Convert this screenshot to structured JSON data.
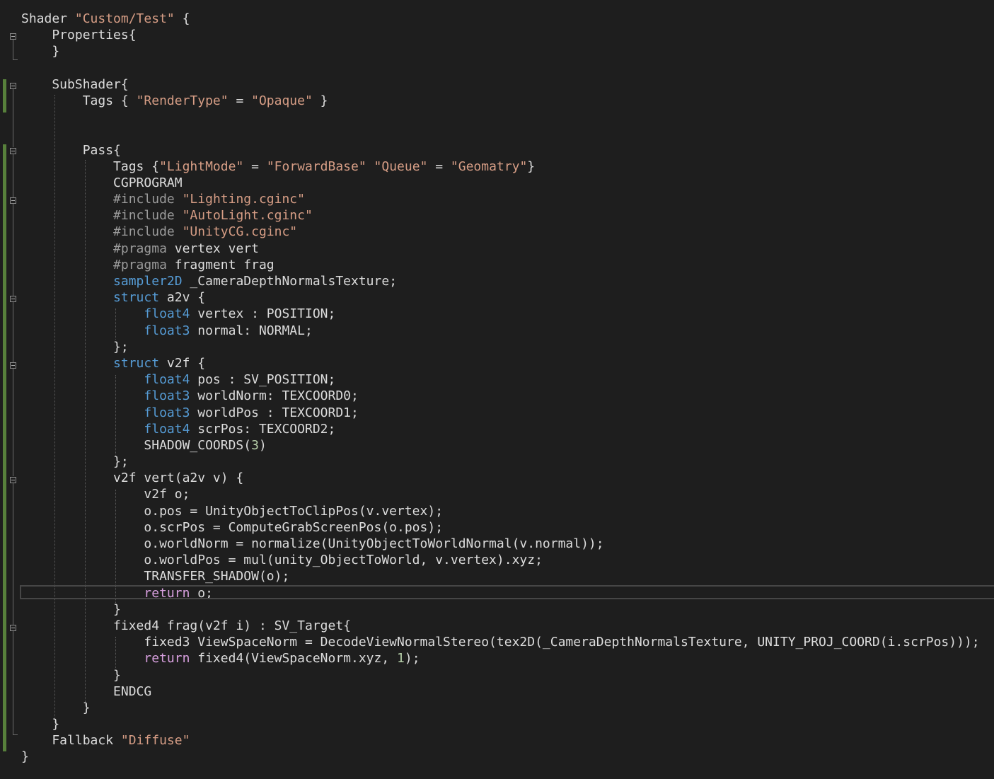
{
  "lines": [
    [
      [
        "",
        "Shader "
      ],
      [
        "str",
        "\"Custom/Test\""
      ],
      [
        "",
        " {"
      ]
    ],
    [
      [
        "",
        "    Properties{"
      ]
    ],
    [
      [
        "",
        "    }"
      ]
    ],
    [],
    [
      [
        "",
        "    SubShader{"
      ]
    ],
    [
      [
        "",
        "        Tags { "
      ],
      [
        "str",
        "\"RenderType\""
      ],
      [
        "",
        " = "
      ],
      [
        "str",
        "\"Opaque\""
      ],
      [
        "",
        " }"
      ]
    ],
    [],
    [],
    [
      [
        "",
        "        Pass{"
      ]
    ],
    [
      [
        "",
        "            Tags {"
      ],
      [
        "str",
        "\"LightMode\""
      ],
      [
        "",
        " = "
      ],
      [
        "str",
        "\"ForwardBase\""
      ],
      [
        "",
        " "
      ],
      [
        "str",
        "\"Queue\""
      ],
      [
        "",
        " = "
      ],
      [
        "str",
        "\"Geomatry\""
      ],
      [
        "",
        "}"
      ]
    ],
    [
      [
        "",
        "            CGPROGRAM"
      ]
    ],
    [
      [
        "",
        "            "
      ],
      [
        "pre",
        "#include"
      ],
      [
        "",
        " "
      ],
      [
        "str",
        "\"Lighting.cginc\""
      ]
    ],
    [
      [
        "",
        "            "
      ],
      [
        "pre",
        "#include"
      ],
      [
        "",
        " "
      ],
      [
        "str",
        "\"AutoLight.cginc\""
      ]
    ],
    [
      [
        "",
        "            "
      ],
      [
        "pre",
        "#include"
      ],
      [
        "",
        " "
      ],
      [
        "str",
        "\"UnityCG.cginc\""
      ]
    ],
    [
      [
        "",
        "            "
      ],
      [
        "pre",
        "#pragma"
      ],
      [
        "",
        " vertex vert"
      ]
    ],
    [
      [
        "",
        "            "
      ],
      [
        "pre",
        "#pragma"
      ],
      [
        "",
        " fragment frag"
      ]
    ],
    [
      [
        "",
        "            "
      ],
      [
        "kw",
        "sampler2D"
      ],
      [
        "",
        " _CameraDepthNormalsTexture;"
      ]
    ],
    [
      [
        "",
        "            "
      ],
      [
        "kw",
        "struct"
      ],
      [
        "",
        " a2v {"
      ]
    ],
    [
      [
        "",
        "                "
      ],
      [
        "kw",
        "float4"
      ],
      [
        "",
        " vertex : POSITION;"
      ]
    ],
    [
      [
        "",
        "                "
      ],
      [
        "kw",
        "float3"
      ],
      [
        "",
        " normal: NORMAL;"
      ]
    ],
    [
      [
        "",
        "            };"
      ]
    ],
    [
      [
        "",
        "            "
      ],
      [
        "kw",
        "struct"
      ],
      [
        "",
        " v2f {"
      ]
    ],
    [
      [
        "",
        "                "
      ],
      [
        "kw",
        "float4"
      ],
      [
        "",
        " pos : SV_POSITION;"
      ]
    ],
    [
      [
        "",
        "                "
      ],
      [
        "kw",
        "float3"
      ],
      [
        "",
        " worldNorm: TEXCOORD0;"
      ]
    ],
    [
      [
        "",
        "                "
      ],
      [
        "kw",
        "float3"
      ],
      [
        "",
        " worldPos : TEXCOORD1;"
      ]
    ],
    [
      [
        "",
        "                "
      ],
      [
        "kw",
        "float4"
      ],
      [
        "",
        " scrPos: TEXCOORD2;"
      ]
    ],
    [
      [
        "",
        "                SHADOW_COORDS("
      ],
      [
        "num",
        "3"
      ],
      [
        "",
        ")"
      ]
    ],
    [
      [
        "",
        "            };"
      ]
    ],
    [
      [
        "",
        "            v2f vert(a2v v) {"
      ]
    ],
    [
      [
        "",
        "                v2f o;"
      ]
    ],
    [
      [
        "",
        "                o.pos = UnityObjectToClipPos(v.vertex);"
      ]
    ],
    [
      [
        "",
        "                o.scrPos = ComputeGrabScreenPos(o.pos);"
      ]
    ],
    [
      [
        "",
        "                o.worldNorm = normalize(UnityObjectToWorldNormal(v.normal));"
      ]
    ],
    [
      [
        "",
        "                o.worldPos = mul(unity_ObjectToWorld, v.vertex).xyz;"
      ]
    ],
    [
      [
        "",
        "                TRANSFER_SHADOW(o);"
      ]
    ],
    [
      [
        "",
        "                "
      ],
      [
        "ret",
        "return"
      ],
      [
        "",
        " o;"
      ]
    ],
    [
      [
        "",
        "            }"
      ]
    ],
    [
      [
        "",
        "            fixed4 frag(v2f i) : SV_Target{"
      ]
    ],
    [
      [
        "",
        "                fixed3 ViewSpaceNorm = DecodeViewNormalStereo(tex2D(_CameraDepthNormalsTexture, UNITY_PROJ_COORD(i.scrPos)));"
      ]
    ],
    [
      [
        "",
        "                "
      ],
      [
        "ret",
        "return"
      ],
      [
        "",
        " fixed4(ViewSpaceNorm.xyz, "
      ],
      [
        "num",
        "1"
      ],
      [
        "",
        ");"
      ]
    ],
    [
      [
        "",
        "            }"
      ]
    ],
    [
      [
        "",
        "            ENDCG"
      ]
    ],
    [
      [
        "",
        "        }"
      ]
    ],
    [
      [
        "",
        "    }"
      ]
    ],
    [
      [
        "",
        "    Fallback "
      ],
      [
        "str",
        "\"Diffuse\""
      ]
    ],
    [
      [
        "",
        "}"
      ]
    ]
  ],
  "current_line": 35,
  "colors": {
    "background": "#1e1e1e",
    "text": "#dcdcdc",
    "string": "#d69d85",
    "keyword": "#569cd6",
    "control": "#d8a0df",
    "preprocessor": "#9b9b9b",
    "number": "#b5cea8",
    "change_bar": "#57803b"
  }
}
